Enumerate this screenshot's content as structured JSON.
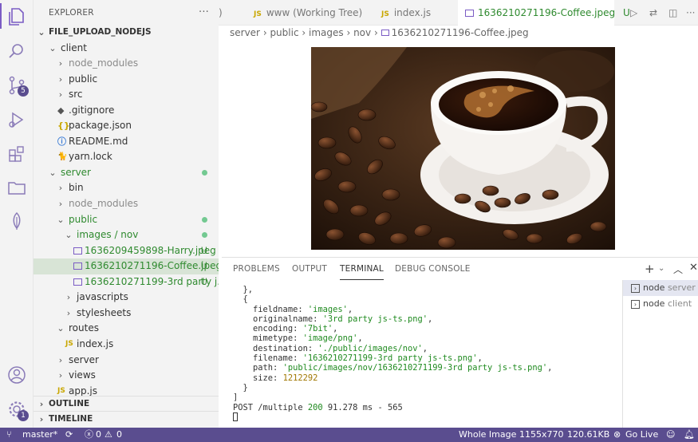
{
  "sidebar": {
    "title": "EXPLORER",
    "more": "···",
    "project": "FILE_UPLOAD_NODEJS",
    "tree": [
      {
        "label": "client",
        "depth": 1,
        "kind": "folder-open"
      },
      {
        "label": "node_modules",
        "depth": 2,
        "kind": "folder",
        "dim": true
      },
      {
        "label": "public",
        "depth": 2,
        "kind": "folder"
      },
      {
        "label": "src",
        "depth": 2,
        "kind": "folder"
      },
      {
        "label": ".gitignore",
        "depth": 2,
        "kind": "file",
        "icon": "◆"
      },
      {
        "label": "package.json",
        "depth": 2,
        "kind": "file",
        "icon": "{}"
      },
      {
        "label": "README.md",
        "depth": 2,
        "kind": "file",
        "icon": "ⓘ"
      },
      {
        "label": "yarn.lock",
        "depth": 2,
        "kind": "file",
        "icon": "🐈"
      },
      {
        "label": "server",
        "depth": 1,
        "kind": "folder-open",
        "git": true,
        "dot": true
      },
      {
        "label": "bin",
        "depth": 2,
        "kind": "folder"
      },
      {
        "label": "node_modules",
        "depth": 2,
        "kind": "folder",
        "dim": true
      },
      {
        "label": "public",
        "depth": 2,
        "kind": "folder-open",
        "git": true,
        "dot": true
      },
      {
        "label": "images / nov",
        "depth": 3,
        "kind": "folder-open",
        "git": true,
        "dot": true
      },
      {
        "label": "1636209459898-Harry.jpeg",
        "depth": 4,
        "kind": "image",
        "git": true,
        "status": "U"
      },
      {
        "label": "1636210271196-Coffee.jpeg",
        "depth": 4,
        "kind": "image",
        "git": true,
        "status": "U",
        "selected": true
      },
      {
        "label": "1636210271199-3rd party j...",
        "depth": 4,
        "kind": "image",
        "git": true,
        "status": "U"
      },
      {
        "label": "javascripts",
        "depth": 3,
        "kind": "folder"
      },
      {
        "label": "stylesheets",
        "depth": 3,
        "kind": "folder"
      },
      {
        "label": "routes",
        "depth": 2,
        "kind": "folder-open"
      },
      {
        "label": "index.js",
        "depth": 3,
        "kind": "js",
        "icon": "JS"
      },
      {
        "label": "server",
        "depth": 2,
        "kind": "folder"
      },
      {
        "label": "views",
        "depth": 2,
        "kind": "folder"
      },
      {
        "label": "app.js",
        "depth": 2,
        "kind": "js",
        "icon": "JS"
      }
    ],
    "outline": "OUTLINE",
    "timeline": "TIMELINE"
  },
  "activity": {
    "scm_badge": "5",
    "account_badge": "1"
  },
  "tabs": [
    {
      "label": ")",
      "type": "partial"
    },
    {
      "label": "www (Working Tree)",
      "type": "js",
      "icon": "JS"
    },
    {
      "label": "index.js",
      "type": "js",
      "icon": "JS"
    },
    {
      "label": "1636210271196-Coffee.jpeg",
      "type": "image",
      "active": true,
      "status": "U"
    }
  ],
  "breadcrumb": [
    "server",
    "public",
    "images",
    "nov",
    "1636210271196-Coffee.jpeg"
  ],
  "panel": {
    "tabs": [
      "PROBLEMS",
      "OUTPUT",
      "TERMINAL",
      "DEBUG CONSOLE"
    ],
    "active_tab": "TERMINAL",
    "terminal_lines": [
      "  },",
      "  {",
      "    fieldname: 'images',",
      "    originalname: '3rd party js-ts.png',",
      "    encoding: '7bit',",
      "    mimetype: 'image/png',",
      "    destination: './public/images/nov',",
      "    filename: '1636210271199-3rd party js-ts.png',",
      "    path: 'public/images/nov/1636210271199-3rd party js-ts.png',",
      "    size: 1212292",
      "  }",
      "]",
      "POST /multiple 200 91.278 ms - 565"
    ],
    "terminals": [
      {
        "label": "node",
        "sub": "server",
        "selected": true
      },
      {
        "label": "node",
        "sub": "client"
      }
    ]
  },
  "status": {
    "branch": "master*",
    "errors": "0",
    "warnings": "0",
    "zoom": "Whole Image",
    "dimensions": "1155x770",
    "size": "120.61KB",
    "golive": "Go Live"
  },
  "colors": {
    "accent": "#5a4d8f",
    "git_untracked": "#2f8a2f",
    "selection": "#d8e4d6"
  }
}
